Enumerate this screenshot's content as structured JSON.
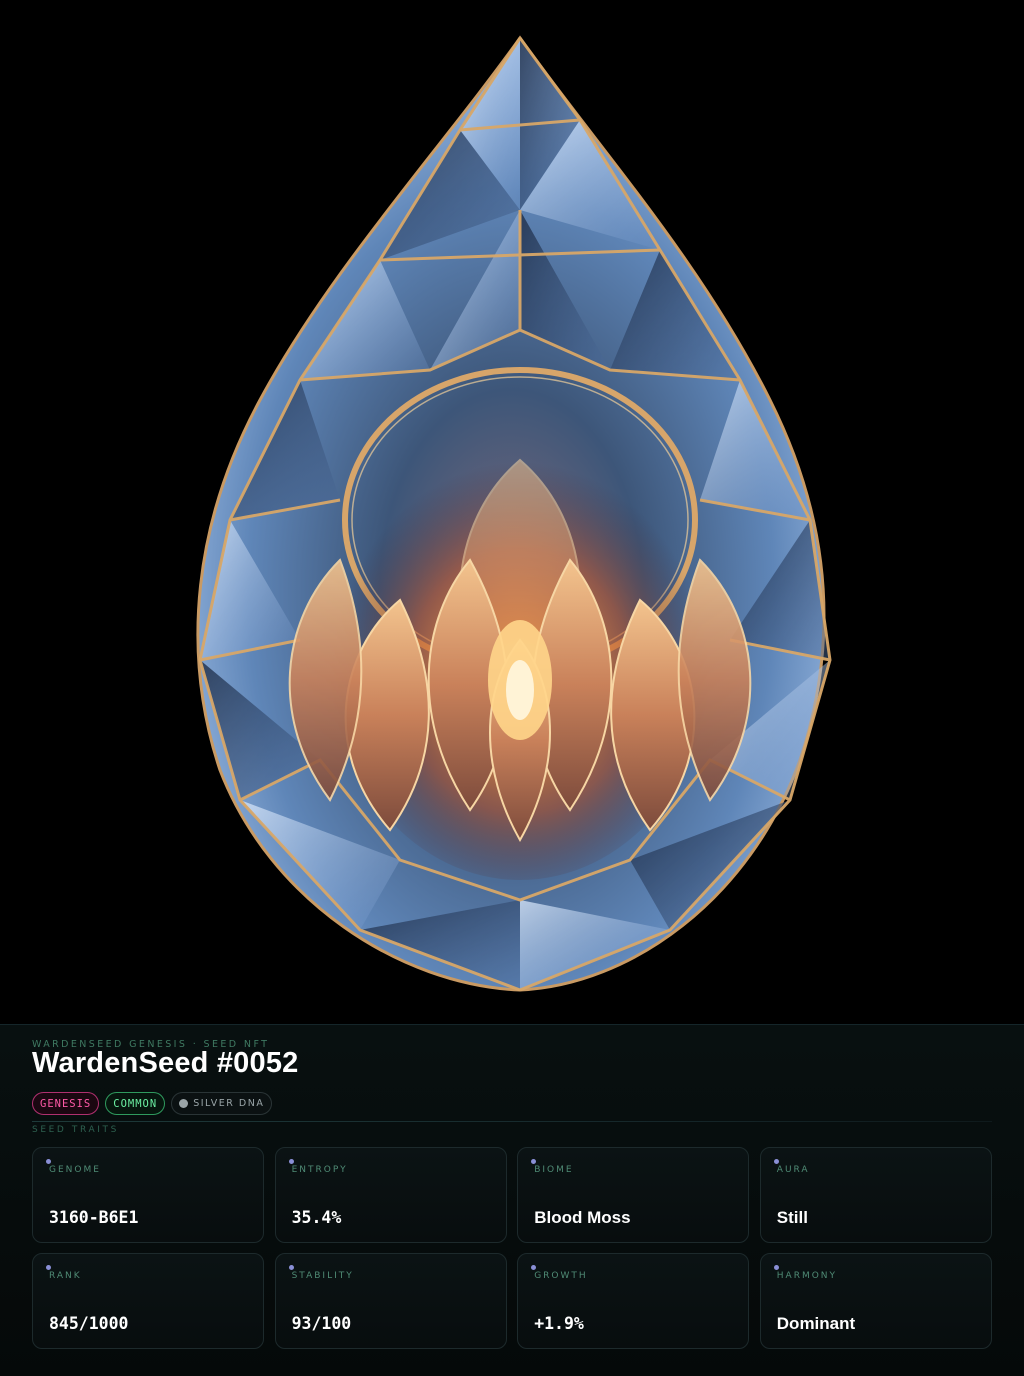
{
  "nft": {
    "eyebrow": "WARDENSEED GENESIS · SEED NFT",
    "title": "WardenSeed #0052",
    "badges": {
      "genesis": "GENESIS",
      "common": "COMMON",
      "dna": "SILVER DNA"
    },
    "section_label": "SEED TRAITS"
  },
  "traits": [
    {
      "label": "GENOME",
      "value": "3160-B6E1"
    },
    {
      "label": "ENTROPY",
      "value": "35.4%"
    },
    {
      "label": "BIOME",
      "value": "Blood Moss"
    },
    {
      "label": "AURA",
      "value": "Still"
    },
    {
      "label": "RANK",
      "value": "845/1000"
    },
    {
      "label": "STABILITY",
      "value": "93/100"
    },
    {
      "label": "GROWTH",
      "value": "+1.9%"
    },
    {
      "label": "HARMONY",
      "value": "Dominant"
    }
  ],
  "colors": {
    "accent_pink": "#ff5aa7",
    "accent_green": "#6cf0a3",
    "label_green": "#4f8b75",
    "dot_violet": "#8a8fd6",
    "crystal_blue": "#8fb4e8",
    "gold": "#d9a45c",
    "core_glow": "#ff8a3c"
  },
  "artwork": {
    "icon": "crystal-seed-artwork"
  }
}
